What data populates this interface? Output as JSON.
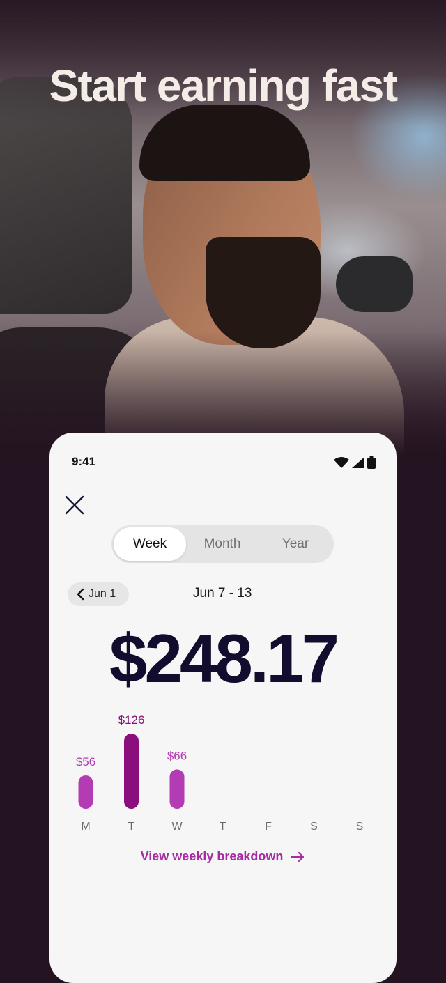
{
  "hero": {
    "title": "Start earning fast"
  },
  "status_bar": {
    "time": "9:41"
  },
  "tabs": [
    {
      "label": "Week",
      "active": true
    },
    {
      "label": "Month",
      "active": false
    },
    {
      "label": "Year",
      "active": false
    }
  ],
  "period": {
    "prev_label": "Jun 1",
    "range": "Jun 7 - 13"
  },
  "earnings": {
    "total": "$248.17"
  },
  "chart_data": {
    "type": "bar",
    "categories": [
      "M",
      "T",
      "W",
      "T",
      "F",
      "S",
      "S"
    ],
    "values": [
      56,
      126,
      66,
      0,
      0,
      0,
      0
    ],
    "value_labels": [
      "$56",
      "$126",
      "$66",
      "",
      "",
      "",
      ""
    ],
    "highlight_index": 1,
    "colors": {
      "default": "#b33bb4",
      "highlight": "#8a0f7c"
    }
  },
  "footer_link": {
    "label": "View weekly breakdown"
  },
  "colors": {
    "accent": "#a82ba4",
    "background": "#241320",
    "total_text": "#120d2e"
  }
}
